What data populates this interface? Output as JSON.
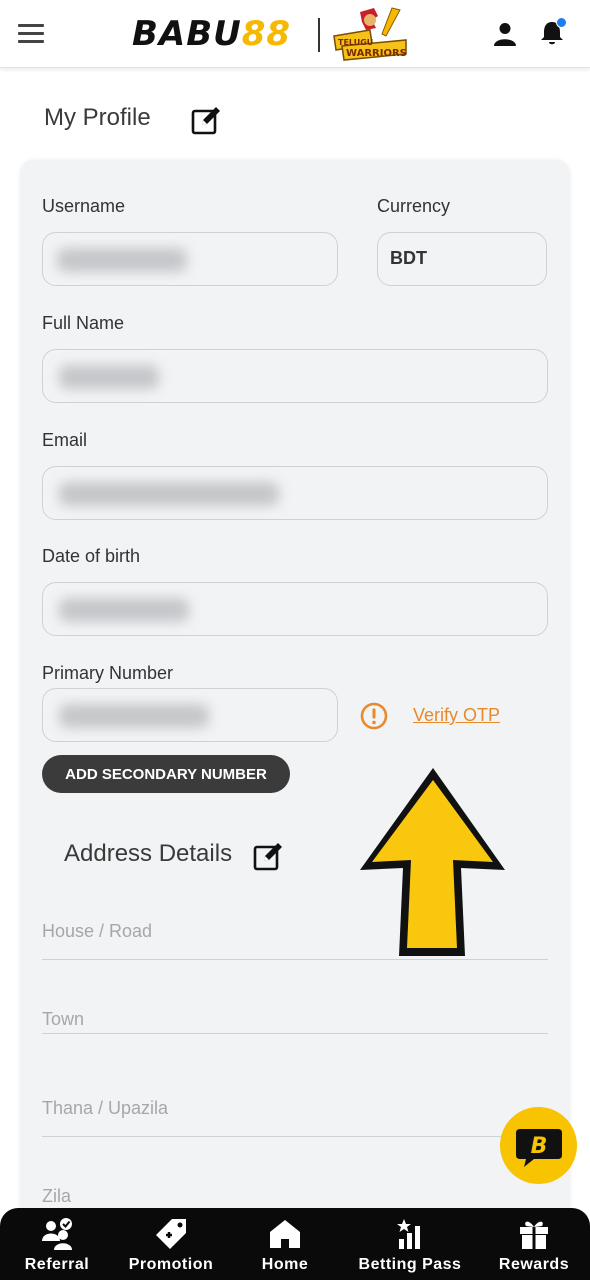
{
  "header": {
    "logo_main": "BABU",
    "logo_num": "88",
    "team_logo_text": "TELUGU WARRIORS",
    "menu_icon": "hamburger-icon",
    "user_icon": "user-icon",
    "bell_icon": "bell-icon",
    "notification_dot_color": "#1e7df0"
  },
  "page": {
    "title": "My Profile"
  },
  "form": {
    "username": {
      "label": "Username",
      "value": ""
    },
    "currency": {
      "label": "Currency",
      "value": "BDT"
    },
    "full_name": {
      "label": "Full Name",
      "value": ""
    },
    "email": {
      "label": "Email",
      "value": ""
    },
    "dob": {
      "label": "Date of birth",
      "value": ""
    },
    "primary_number": {
      "label": "Primary Number",
      "value": ""
    },
    "verify_otp": "Verify OTP",
    "add_secondary": "ADD SECONDARY NUMBER"
  },
  "address": {
    "title": "Address Details",
    "fields": [
      {
        "placeholder": "House / Road"
      },
      {
        "placeholder": "Town"
      },
      {
        "placeholder": "Thana / Upazila"
      },
      {
        "placeholder": "Zila"
      }
    ]
  },
  "nav": [
    {
      "label": "Referral",
      "icon": "referral-icon"
    },
    {
      "label": "Promotion",
      "icon": "promotion-tag-icon"
    },
    {
      "label": "Home",
      "icon": "home-icon"
    },
    {
      "label": "Betting Pass",
      "icon": "betting-pass-icon"
    },
    {
      "label": "Rewards",
      "icon": "gift-icon"
    }
  ],
  "colors": {
    "accent_yellow": "#f8c300",
    "verify_orange": "#e8892a",
    "nav_bg": "#0a0a0a"
  }
}
